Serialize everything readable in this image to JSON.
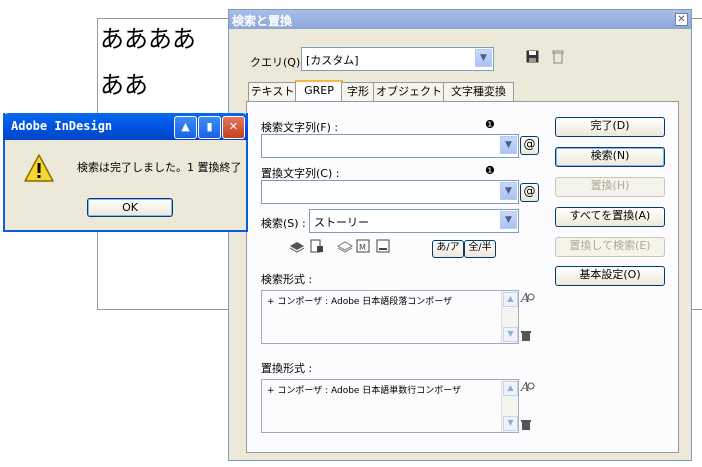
{
  "document": {
    "line1": "ああああ",
    "line2": "ああ"
  },
  "dialog": {
    "title": "検索と置換",
    "close_glyph": "✕",
    "query_label": "クエリ(Q) :",
    "query_value": "[カスタム]",
    "tabs": [
      "テキスト",
      "GREP",
      "字形",
      "オブジェクト",
      "文字種変換"
    ],
    "find_label": "検索文字列(F) :",
    "find_value": "",
    "change_label": "置換文字列(C) :",
    "change_value": "",
    "search_label": "検索(S) :",
    "search_value": "ストーリー",
    "kana_toggle": "あ/ア",
    "width_toggle": "全/半",
    "find_format_label": "検索形式 :",
    "find_format_value": "+ コンポーザ : Adobe 日本語段落コンポーザ",
    "change_format_label": "置換形式 :",
    "change_format_value": "+ コンポーザ : Adobe 日本語単数行コンポーザ",
    "buttons": {
      "done": "完了(D)",
      "find": "検索(N)",
      "change": "置換(H)",
      "change_all": "すべてを置換(A)",
      "change_find": "置換して検索(E)",
      "more_options": "基本設定(O)"
    }
  },
  "alert": {
    "title": "Adobe InDesign",
    "message": "検索は完了しました。1 置換終了",
    "ok_label": "OK"
  },
  "colors": {
    "xp_blue_title": "#0054e3",
    "dialog_bg": "#ece9d8",
    "active_tab_accent": "#f6b54b"
  }
}
